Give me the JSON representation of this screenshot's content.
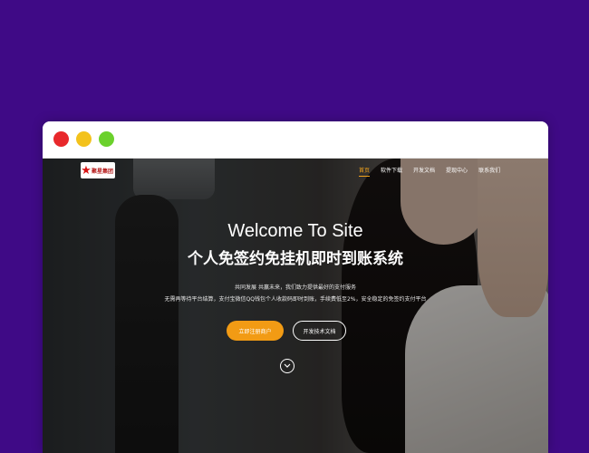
{
  "window": {
    "controls": [
      "close",
      "minimize",
      "maximize"
    ],
    "colors": {
      "close": "#e8282b",
      "minimize": "#f3c21c",
      "maximize": "#6bd12c"
    }
  },
  "site": {
    "logo_text": "聚星集团",
    "logo_icon": "star-icon",
    "nav": [
      {
        "label": "首页",
        "active": true
      },
      {
        "label": "软件下载",
        "active": false
      },
      {
        "label": "开发文档",
        "active": false
      },
      {
        "label": "提现中心",
        "active": false
      },
      {
        "label": "联系我们",
        "active": false
      }
    ],
    "hero": {
      "title_en": "Welcome To Site",
      "title_cn": "个人免签约免挂机即时到账系统",
      "subtitle_1": "共同发展 共赢未来，我们致力提供最好的支付服务",
      "subtitle_2": "无需再等待平台结算，支付宝微信QQ钱包个人收款码即时到账，手续费低至2%，安全稳定的免签约支付平台",
      "primary_button": "立即注册商户",
      "secondary_button": "开发技术文档",
      "scroll_icon": "chevron-down-icon"
    },
    "colors": {
      "accent": "#f29b14",
      "page_background": "#3f0a86"
    }
  }
}
